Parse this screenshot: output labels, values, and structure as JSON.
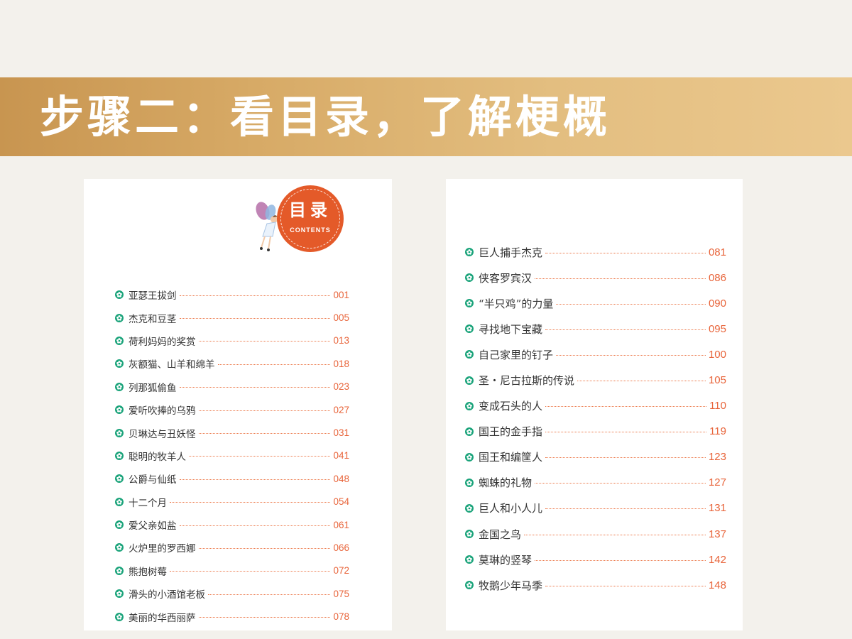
{
  "banner": {
    "title": "步骤二：看目录，了解梗概"
  },
  "toc_header": {
    "title": "目录",
    "subtitle": "CONTENTS"
  },
  "colors": {
    "banner_start": "#c89550",
    "banner_end": "#ebc88e",
    "badge": "#e45a29",
    "bullet": "#1aa37a",
    "page_number": "#e8643a"
  },
  "left_page": {
    "items": [
      {
        "title": "亚瑟王拔剑",
        "page": "001"
      },
      {
        "title": "杰克和豆茎",
        "page": "005"
      },
      {
        "title": "荷利妈妈的奖赏",
        "page": "013"
      },
      {
        "title": "灰额猫、山羊和绵羊",
        "page": "018"
      },
      {
        "title": "列那狐偷鱼",
        "page": "023"
      },
      {
        "title": "爱听吹捧的乌鸦",
        "page": "027"
      },
      {
        "title": "贝琳达与丑妖怪",
        "page": "031"
      },
      {
        "title": "聪明的牧羊人",
        "page": "041"
      },
      {
        "title": "公爵与仙纸",
        "page": "048"
      },
      {
        "title": "十二个月",
        "page": "054"
      },
      {
        "title": "爱父亲如盐",
        "page": "061"
      },
      {
        "title": "火炉里的罗西娜",
        "page": "066"
      },
      {
        "title": "熊抱树莓",
        "page": "072"
      },
      {
        "title": "滑头的小酒馆老板",
        "page": "075"
      },
      {
        "title": "美丽的华西丽萨",
        "page": "078"
      }
    ]
  },
  "right_page": {
    "items": [
      {
        "title": "巨人捕手杰克",
        "page": "081"
      },
      {
        "title": "侠客罗宾汉",
        "page": "086"
      },
      {
        "title": "“半只鸡”的力量",
        "page": "090"
      },
      {
        "title": "寻找地下宝藏",
        "page": "095"
      },
      {
        "title": "自己家里的钉子",
        "page": "100"
      },
      {
        "title": "圣・尼古拉斯的传说",
        "page": "105"
      },
      {
        "title": "变成石头的人",
        "page": "110"
      },
      {
        "title": "国王的金手指",
        "page": "119"
      },
      {
        "title": "国王和编筐人",
        "page": "123"
      },
      {
        "title": "蜘蛛的礼物",
        "page": "127"
      },
      {
        "title": "巨人和小人儿",
        "page": "131"
      },
      {
        "title": "金国之鸟",
        "page": "137"
      },
      {
        "title": "莫琳的竖琴",
        "page": "142"
      },
      {
        "title": "牧鹅少年马季",
        "page": "148"
      }
    ]
  }
}
